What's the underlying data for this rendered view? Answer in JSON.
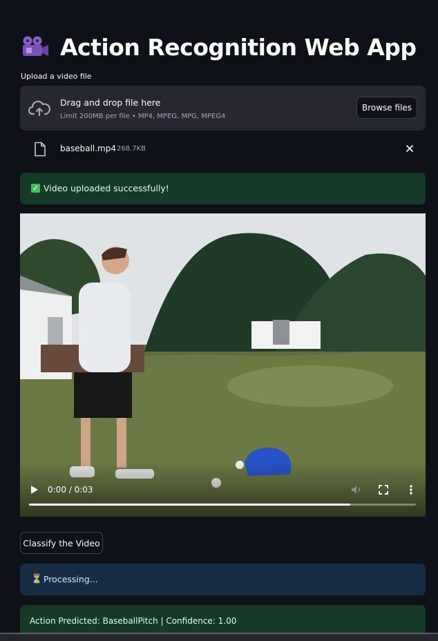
{
  "header": {
    "title": "Action Recognition Web App",
    "icon": "film-projector-icon"
  },
  "uploader": {
    "label": "Upload a video file",
    "dropzone_title": "Drag and drop file here",
    "dropzone_subtitle": "Limit 200MB per file • MP4, MPEG, MPG, MPEG4",
    "browse_label": "Browse files",
    "icon": "cloud-upload-icon"
  },
  "uploaded_file": {
    "name": "baseball.mp4",
    "size": "268.7KB",
    "icon": "file-icon"
  },
  "success_alert": {
    "text": "Video uploaded successfully!",
    "icon": "check-box-icon",
    "color": "#173928"
  },
  "video_player": {
    "time": "0:00 / 0:03",
    "progress": 0.83,
    "controls": [
      "play-icon",
      "volume-icon",
      "fullscreen-icon",
      "more-options-icon"
    ]
  },
  "classify_button": {
    "label": "Classify the Video"
  },
  "processing_alert": {
    "text": "Processing...",
    "icon": "hourglass-icon",
    "color": "#172d43"
  },
  "result_alert": {
    "text": "Action Predicted: BaseballPitch | Confidence: 1.00",
    "color": "#173928"
  },
  "colors": {
    "background": "#0e1117",
    "widget": "#262730",
    "text": "#fafafa"
  }
}
